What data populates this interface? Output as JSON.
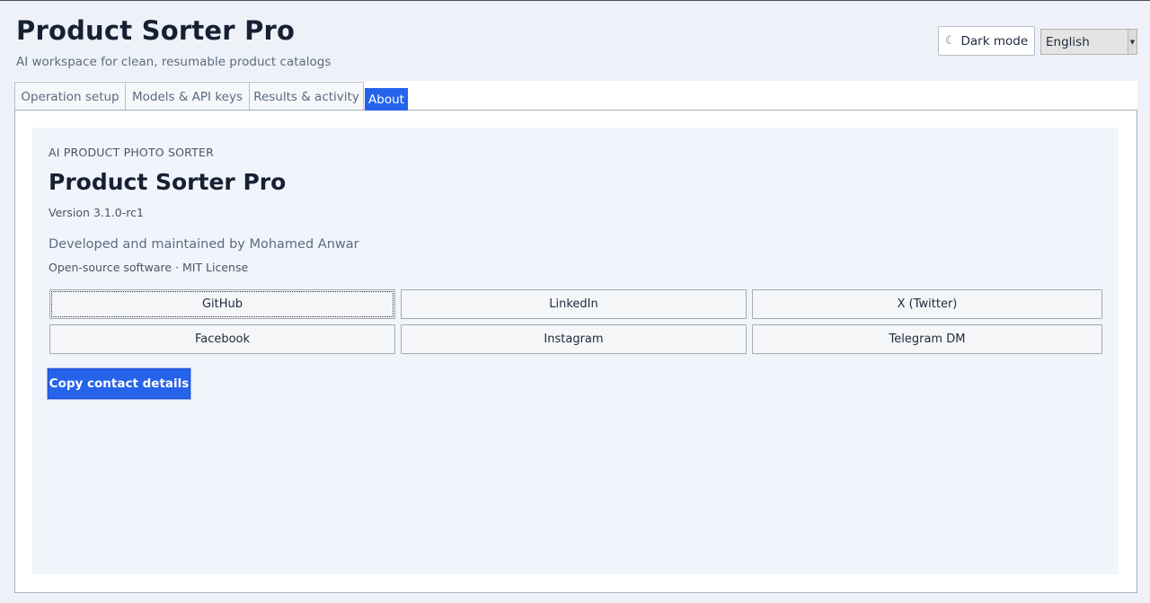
{
  "header": {
    "title": "Product Sorter Pro",
    "subtitle": "AI workspace for clean, resumable product catalogs",
    "dark_mode_icon": "moon-icon",
    "dark_mode_glyph": "☾",
    "dark_mode_label": "Dark mode",
    "language_value": "English"
  },
  "tabs": [
    {
      "label": "Operation setup",
      "active": false
    },
    {
      "label": "Models & API keys",
      "active": false
    },
    {
      "label": "Results & activity",
      "active": false
    },
    {
      "label": "About",
      "active": true
    }
  ],
  "about": {
    "eyebrow": "AI PRODUCT PHOTO SORTER",
    "title": "Product Sorter Pro",
    "version": "Version 3.1.0-rc1",
    "developer": "Developed and maintained by Mohamed Anwar",
    "license": "Open-source software · MIT License",
    "links": [
      {
        "label": "GitHub"
      },
      {
        "label": "LinkedIn"
      },
      {
        "label": "X (Twitter)"
      },
      {
        "label": "Facebook"
      },
      {
        "label": "Instagram"
      },
      {
        "label": "Telegram DM"
      }
    ],
    "copy_label": "Copy contact details"
  },
  "colors": {
    "accent": "#2563eb",
    "background": "#eef2f8",
    "title": "#172033"
  }
}
